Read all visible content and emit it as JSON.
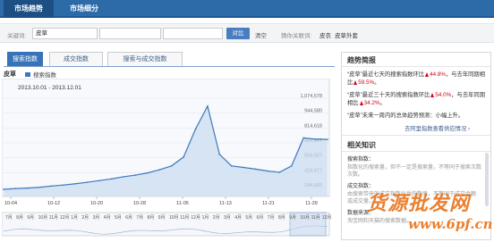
{
  "nav": {
    "tabs": [
      {
        "label": "市场趋势",
        "active": true
      },
      {
        "label": "市场细分",
        "active": false
      }
    ]
  },
  "search": {
    "label": "关键词:",
    "value1": "皮草",
    "value2": "",
    "value3": "",
    "compare_label": "对比",
    "clear_label": "清空",
    "recommend_label": "猜你关联词:",
    "recommend": [
      "皮衣",
      "皮草外套"
    ]
  },
  "index_tabs": [
    {
      "label": "搜索指数",
      "active": true
    },
    {
      "label": "成交指数",
      "active": false
    },
    {
      "label": "搜索与成交指数",
      "active": false
    }
  ],
  "subject": {
    "keyword": "皮草",
    "legend": "搜索指数",
    "legend_color": "#3c78be"
  },
  "chart_data": {
    "type": "area",
    "title": "",
    "date_range": "2013.10.01 - 2013.12.01",
    "series": [
      {
        "name": "搜索指数",
        "color": "#3c78be",
        "x": [
          "10-01",
          "10-04",
          "10-07",
          "10-10",
          "10-12",
          "10-14",
          "10-17",
          "10-20",
          "10-23",
          "10-25",
          "10-28",
          "10-31",
          "11-02",
          "11-05",
          "11-07",
          "11-09",
          "11-10",
          "11-11",
          "11-12",
          "11-13",
          "11-15",
          "11-18",
          "11-21",
          "11-24",
          "11-26",
          "11-27",
          "11-29",
          "12-01"
        ],
        "values": [
          286000,
          292000,
          296000,
          302000,
          312000,
          320000,
          330000,
          342000,
          355000,
          368000,
          385000,
          398000,
          415000,
          440000,
          470000,
          540000,
          760000,
          940000,
          560000,
          470000,
          458000,
          445000,
          430000,
          420000,
          470000,
          690000,
          680000,
          678000
        ]
      }
    ],
    "y_ticks": [
      "1,074,578",
      "944,580",
      "814,618",
      "684,627",
      "554,587",
      "424,677",
      "294,666"
    ],
    "x_ticks": [
      "10-04",
      "10-12",
      "10-20",
      "10-28",
      "11-05",
      "11-13",
      "11-21",
      "11-29"
    ],
    "overview_ticks": [
      "7月",
      "8月",
      "9月",
      "10月",
      "11月",
      "12月",
      "1月",
      "2月",
      "3月",
      "4月",
      "5月",
      "6月",
      "7月",
      "8月",
      "9月",
      "10月",
      "11月",
      "12月",
      "1月",
      "2月",
      "3月",
      "4月",
      "5月",
      "6月",
      "7月",
      "8月",
      "9月",
      "10月",
      "11月",
      "12月"
    ],
    "ylim": [
      230000,
      1100000
    ],
    "grid": true
  },
  "trend_panel": {
    "title": "趋势简报",
    "items": [
      {
        "prefix": "“皮草”最近七天的搜索指数环比",
        "value1": "44.8%",
        "middle": "，与去年同期相比",
        "value2": "59.5%",
        "suffix": "。"
      },
      {
        "prefix": "“皮草”最近三十天的搜索指数环比",
        "value1": "54.0%",
        "middle": "，与去年同期相比",
        "value2": "34.2%",
        "suffix": "。"
      },
      {
        "prefix": "“皮草”未来一周内的总体趋势预测：小幅上升。",
        "value1": "",
        "middle": "",
        "value2": "",
        "suffix": ""
      }
    ],
    "more_link": "去阿里指数查看供应情况 ›"
  },
  "knowledge": {
    "title": "相关知识",
    "lines": [
      {
        "text": "搜索指数：",
        "kind": "h"
      },
      {
        "text": "指数化的搜索量，但不一定是搜索量，不等同于搜索次数",
        "kind": "b"
      },
      {
        "text": "次数。",
        "kind": "b"
      },
      {
        "text": "成交指数：",
        "kind": "h"
      },
      {
        "text": "由搜索带来的成交指数化后的数值，不等同于成交金额",
        "kind": "b"
      },
      {
        "text": "或成交量。",
        "kind": "b"
      },
      {
        "text": "数据来源：",
        "kind": "h"
      },
      {
        "text": "淘宝网和天猫的搜索数据。",
        "kind": "b"
      }
    ]
  },
  "watermark": {
    "line1": "货源批发网",
    "line2": "www.6pf.cn"
  }
}
